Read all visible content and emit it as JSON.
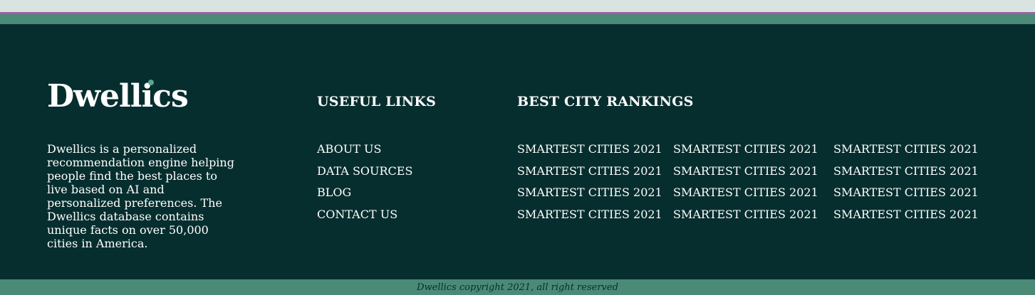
{
  "brand": {
    "name": "Dwellics",
    "description": "Dwellics is a personalized recommendation engine helping people find the best places to live based on AI and personalized preferences. The Dwellics database contains unique facts on over 50,000 cities in America."
  },
  "useful_links": {
    "title": "USEFUL LINKS",
    "items": [
      "ABOUT US",
      "DATA SOURCES",
      "BLOG",
      "CONTACT US"
    ]
  },
  "rankings": {
    "title": "BEST CITY RANKINGS",
    "columns": [
      [
        "SMARTEST CITIES 2021",
        "SMARTEST CITIES 2021",
        "SMARTEST CITIES 2021",
        "SMARTEST CITIES 2021"
      ],
      [
        "SMARTEST CITIES 2021",
        "SMARTEST CITIES 2021",
        "SMARTEST CITIES 2021",
        "SMARTEST CITIES 2021"
      ],
      [
        "SMARTEST CITIES 2021",
        "SMARTEST CITIES 2021",
        "SMARTEST CITIES 2021",
        "SMARTEST CITIES 2021"
      ]
    ]
  },
  "copyright": "Dwellics copyright 2021, all right reserved",
  "colors": {
    "background": "#072e2e",
    "accent": "#4a8a77",
    "dot": "#5aa58f",
    "top_line": "#9b5fa3"
  }
}
